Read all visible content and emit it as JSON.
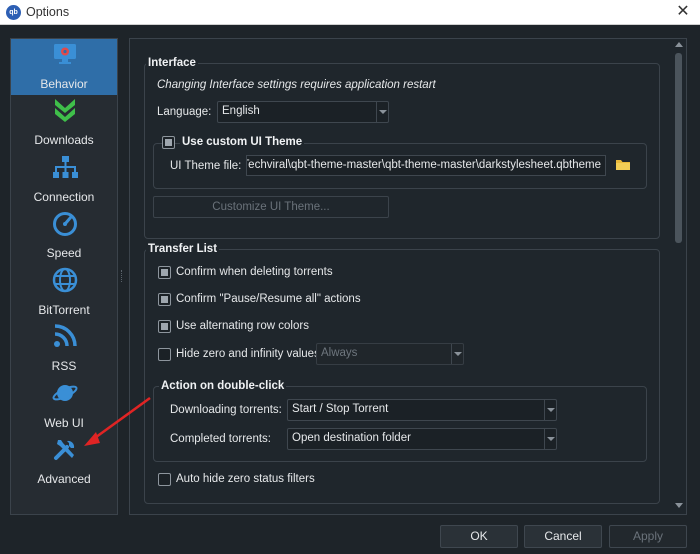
{
  "window": {
    "app_icon_text": "qb",
    "title": "Options",
    "close_glyph": "✕"
  },
  "sidebar": {
    "items": [
      {
        "label": "Behavior",
        "icon": "gear-monitor-icon",
        "active": true
      },
      {
        "label": "Downloads",
        "icon": "double-chevron-down-icon",
        "active": false
      },
      {
        "label": "Connection",
        "icon": "network-icon",
        "active": false
      },
      {
        "label": "Speed",
        "icon": "speedometer-icon",
        "active": false
      },
      {
        "label": "BitTorrent",
        "icon": "globe-icon",
        "active": false
      },
      {
        "label": "RSS",
        "icon": "rss-icon",
        "active": false
      },
      {
        "label": "Web UI",
        "icon": "planet-icon",
        "active": false
      },
      {
        "label": "Advanced",
        "icon": "tools-icon",
        "active": false
      }
    ]
  },
  "interface": {
    "title": "Interface",
    "restart_note": "Changing Interface settings requires application restart",
    "language_label": "Language:",
    "language_value": "English",
    "custom_theme_label": "Use custom UI Theme",
    "custom_theme_checked": true,
    "theme_file_label": "UI Theme file:",
    "theme_file_value": ":\\Techviral\\qbt-theme-master\\qbt-theme-master\\darkstylesheet.qbtheme",
    "customize_button": "Customize UI Theme..."
  },
  "transfer_list": {
    "title": "Transfer List",
    "options": [
      {
        "label": "Confirm when deleting torrents",
        "checked": true
      },
      {
        "label": "Confirm \"Pause/Resume all\" actions",
        "checked": true
      },
      {
        "label": "Use alternating row colors",
        "checked": true
      },
      {
        "label": "Hide zero and infinity values",
        "checked": false
      }
    ],
    "hide_zero_mode": "Always",
    "double_click": {
      "title": "Action on double-click",
      "downloading_label": "Downloading torrents:",
      "downloading_value": "Start / Stop Torrent",
      "completed_label": "Completed torrents:",
      "completed_value": "Open destination folder"
    },
    "auto_hide_label": "Auto hide zero status filters",
    "auto_hide_checked": false
  },
  "footer": {
    "ok": "OK",
    "cancel": "Cancel",
    "apply": "Apply"
  },
  "colors": {
    "background": "#1e2429",
    "active_item": "#2f6ea8",
    "icon_blue": "#3a8fd6",
    "icon_green": "#3fbf4a",
    "annotation_arrow": "#e02424"
  }
}
